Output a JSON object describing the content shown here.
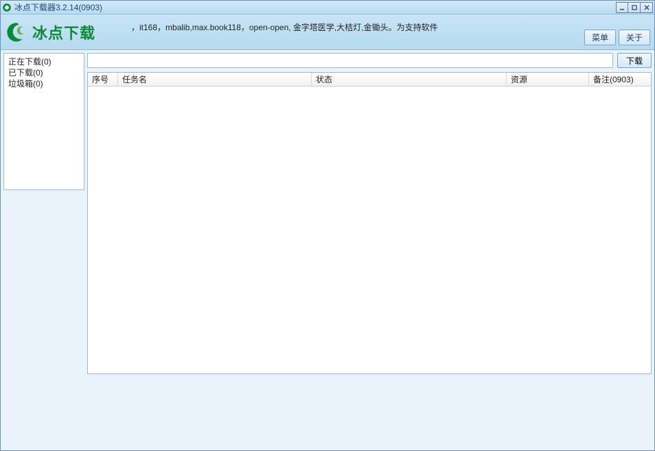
{
  "window": {
    "title": "冰点下载器3.2.14(0903)"
  },
  "header": {
    "app_name": "冰点下载",
    "marquee_text": "，it168，mbalib,max.book118，open-open, 金字塔医学,大桔灯,金锄头。为支持软件",
    "menu_label": "菜单",
    "about_label": "关于"
  },
  "sidebar": {
    "items": [
      {
        "label": "正在下载(0)"
      },
      {
        "label": "已下载(0)"
      },
      {
        "label": "垃圾箱(0)"
      }
    ]
  },
  "url_bar": {
    "value": "",
    "placeholder": "",
    "download_label": "下载"
  },
  "table": {
    "columns": {
      "index": "序号",
      "task_name": "任务名",
      "status": "状态",
      "resource": "资源",
      "note": "备注(0903)"
    },
    "rows": []
  }
}
